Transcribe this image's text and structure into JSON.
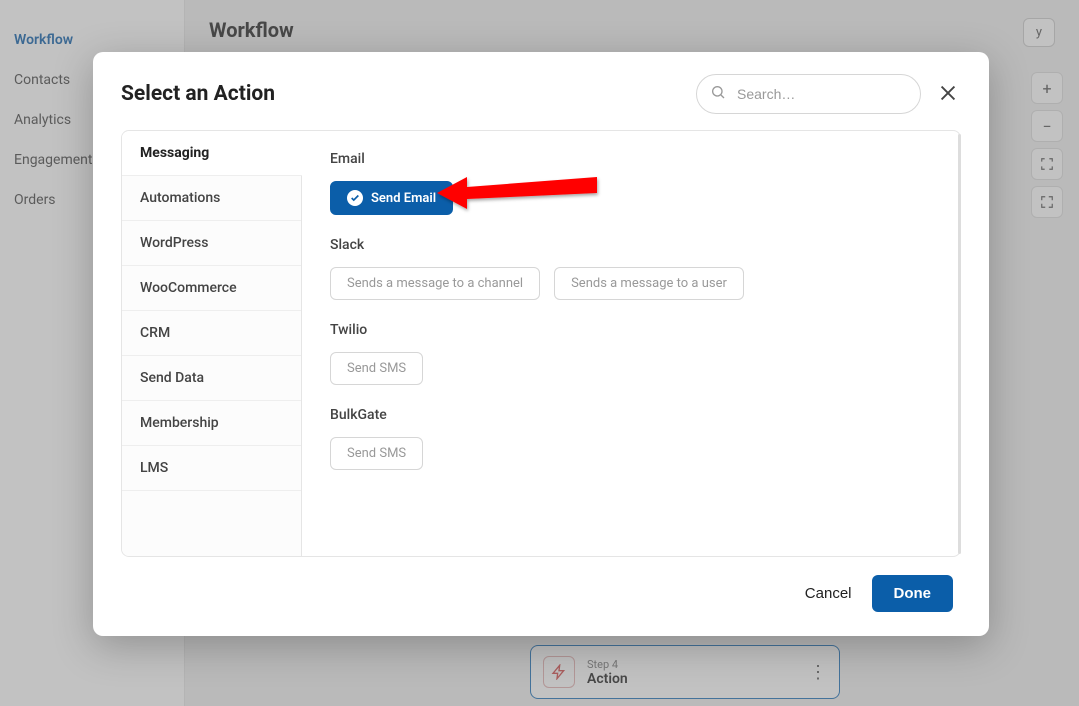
{
  "bg": {
    "sidebar": [
      "Workflow",
      "Contacts",
      "Analytics",
      "Engagement",
      "Orders"
    ],
    "active_sidebar": 0,
    "page_title": "Workflow",
    "top_btn_suffix": "y",
    "workflow_card": {
      "step": "Step 4",
      "title": "Action"
    }
  },
  "modal": {
    "title": "Select an Action",
    "search_placeholder": "Search…",
    "categories": [
      "Messaging",
      "Automations",
      "WordPress",
      "WooCommerce",
      "CRM",
      "Send Data",
      "Membership",
      "LMS"
    ],
    "active_category": 0,
    "groups": [
      {
        "label": "Email",
        "chips": [
          {
            "label": "Send Email",
            "selected": true
          }
        ]
      },
      {
        "label": "Slack",
        "chips": [
          {
            "label": "Sends a message to a channel"
          },
          {
            "label": "Sends a message to a user"
          }
        ]
      },
      {
        "label": "Twilio",
        "chips": [
          {
            "label": "Send SMS"
          }
        ]
      },
      {
        "label": "BulkGate",
        "chips": [
          {
            "label": "Send SMS"
          }
        ]
      }
    ],
    "cancel": "Cancel",
    "done": "Done"
  }
}
